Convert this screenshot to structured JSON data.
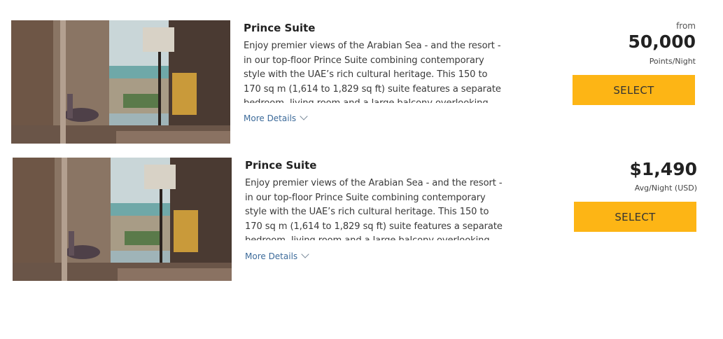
{
  "rooms": [
    {
      "title": "Prince Suite",
      "description": "Enjoy premier views of the Arabian Sea - and the resort - in our top-floor Prince Suite combining contemporary style with the UAE’s rich cultural heritage. This 150 to 170 sq m (1,614 to 1,829 sq ft) suite features a separate bedroom, living room and a large balcony overlooking the",
      "more_details": "More Details",
      "price_prefix": "from",
      "price": "50,000",
      "price_unit": "Points/Night",
      "select_label": "SELECT"
    },
    {
      "title": "Prince Suite",
      "description": "Enjoy premier views of the Arabian Sea - and the resort - in our top-floor Prince Suite combining contemporary style with the UAE’s rich cultural heritage. This 150 to 170 sq m (1,614 to 1,829 sq ft) suite features a separate bedroom, living room and a large balcony overlooking the",
      "more_details": "More Details",
      "price": "$1,490",
      "price_unit": "Avg/Night (USD)",
      "select_label": "SELECT"
    }
  ],
  "colors": {
    "select_button": "#fdb515",
    "link": "#3d6b9a"
  },
  "icons": {
    "more_details": "chevron-down-icon"
  }
}
